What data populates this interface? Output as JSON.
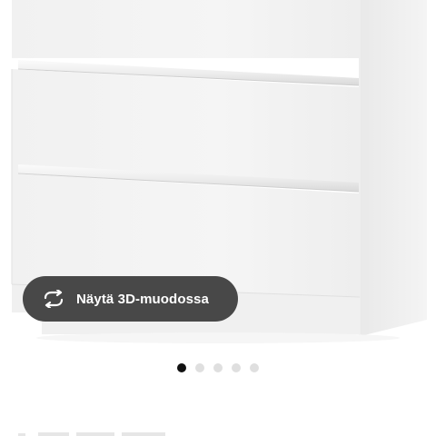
{
  "view_3d_button": {
    "label": "Näytä 3D-muodossa",
    "icon": "rotate-arrows-icon"
  },
  "carousel": {
    "total": 5,
    "active_index": 0
  },
  "colors": {
    "button_bg": "#484848",
    "dot_active": "#111111",
    "dot_inactive": "#dfdfdf",
    "dresser": "#f3f3f3"
  }
}
